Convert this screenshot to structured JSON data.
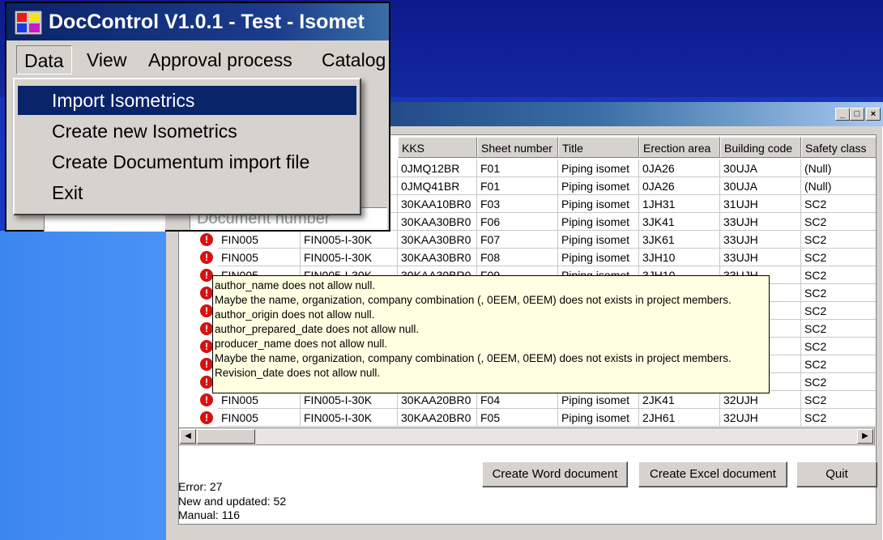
{
  "front_window": {
    "title": "DocControl V1.0.1 - Test - Isomet",
    "menu": [
      "Data",
      "View",
      "Approval process",
      "Catalog"
    ],
    "dropdown": [
      "Import Isometrics",
      "Create new Isometrics",
      "Create Documentum import file",
      "Exit"
    ],
    "document_number_placeholder": "Document number"
  },
  "back_window": {
    "caption_buttons": [
      "_",
      "□",
      "×"
    ],
    "columns": [
      "KKS",
      "Sheet number",
      "Title",
      "Erection area",
      "Building code",
      "Safety class"
    ],
    "rows": [
      {
        "c1": "",
        "c2": "",
        "kks": "0JMQ12BR",
        "sheet": "F01",
        "title": "Piping isomet",
        "area": "0JA26",
        "building": "30UJA",
        "safety": "(Null)"
      },
      {
        "c1": "",
        "c2": "",
        "kks": "0JMQ41BR",
        "sheet": "F01",
        "title": "Piping isomet",
        "area": "0JA26",
        "building": "30UJA",
        "safety": "(Null)"
      },
      {
        "c1": "",
        "c2": "",
        "kks": "30KAA10BR0",
        "sheet": "F03",
        "title": "Piping isomet",
        "area": "1JH31",
        "building": "31UJH",
        "safety": "SC2"
      },
      {
        "c1": "",
        "c2": "",
        "kks": "30KAA30BR0",
        "sheet": "F06",
        "title": "Piping isomet",
        "area": "3JK41",
        "building": "33UJH",
        "safety": "SC2"
      },
      {
        "c1": "FIN005",
        "c2": "FIN005-I-30K",
        "kks": "30KAA30BR0",
        "sheet": "F07",
        "title": "Piping isomet",
        "area": "3JK61",
        "building": "33UJH",
        "safety": "SC2"
      },
      {
        "c1": "FIN005",
        "c2": "FIN005-I-30K",
        "kks": "30KAA30BR0",
        "sheet": "F08",
        "title": "Piping isomet",
        "area": "3JH10",
        "building": "33UJH",
        "safety": "SC2"
      },
      {
        "c1": "FIN005",
        "c2": "FIN005-I-30K",
        "kks": "30KAA30BR0",
        "sheet": "F09",
        "title": "Piping isomet",
        "area": "3JH10",
        "building": "33UJH",
        "safety": "SC2"
      },
      {
        "c1": "",
        "c2": "",
        "kks": "",
        "sheet": "",
        "title": "",
        "area": "",
        "building": "",
        "safety": "SC2"
      },
      {
        "c1": "",
        "c2": "",
        "kks": "",
        "sheet": "",
        "title": "",
        "area": "",
        "building": "",
        "safety": "SC2"
      },
      {
        "c1": "",
        "c2": "",
        "kks": "",
        "sheet": "",
        "title": "",
        "area": "",
        "building": "",
        "safety": "SC2"
      },
      {
        "c1": "",
        "c2": "",
        "kks": "",
        "sheet": "",
        "title": "",
        "area": "",
        "building": "",
        "safety": "SC2"
      },
      {
        "c1": "",
        "c2": "",
        "kks": "",
        "sheet": "",
        "title": "",
        "area": "",
        "building": "",
        "safety": "SC2"
      },
      {
        "c1": "",
        "c2": "",
        "kks": "",
        "sheet": "",
        "title": "",
        "area": "",
        "building": "",
        "safety": "SC2"
      },
      {
        "c1": "FIN005",
        "c2": "FIN005-I-30K",
        "kks": "30KAA20BR0",
        "sheet": "F04",
        "title": "Piping isomet",
        "area": "2JK41",
        "building": "32UJH",
        "safety": "SC2"
      },
      {
        "c1": "FIN005",
        "c2": "FIN005-I-30K",
        "kks": "30KAA20BR0",
        "sheet": "F05",
        "title": "Piping isomet",
        "area": "2JH61",
        "building": "32UJH",
        "safety": "SC2"
      }
    ],
    "tooltip": [
      "author_name does not allow null.",
      "Maybe the name, organization, company combination (, 0EEM, 0EEM) does not exists in project members.",
      "author_origin does not allow null.",
      "author_prepared_date does not allow null.",
      "producer_name does not allow null.",
      "Maybe the name, organization, company combination (, 0EEM, 0EEM) does not exists in project members.",
      "Revision_date does not allow null."
    ],
    "buttons": {
      "word": "Create  Word document",
      "excel": "Create Excel document",
      "quit": "Quit"
    },
    "status": {
      "error": "Error: 27",
      "new_updated": "New and updated: 52",
      "manual": "Manual: 116"
    },
    "error_icon": "!"
  }
}
